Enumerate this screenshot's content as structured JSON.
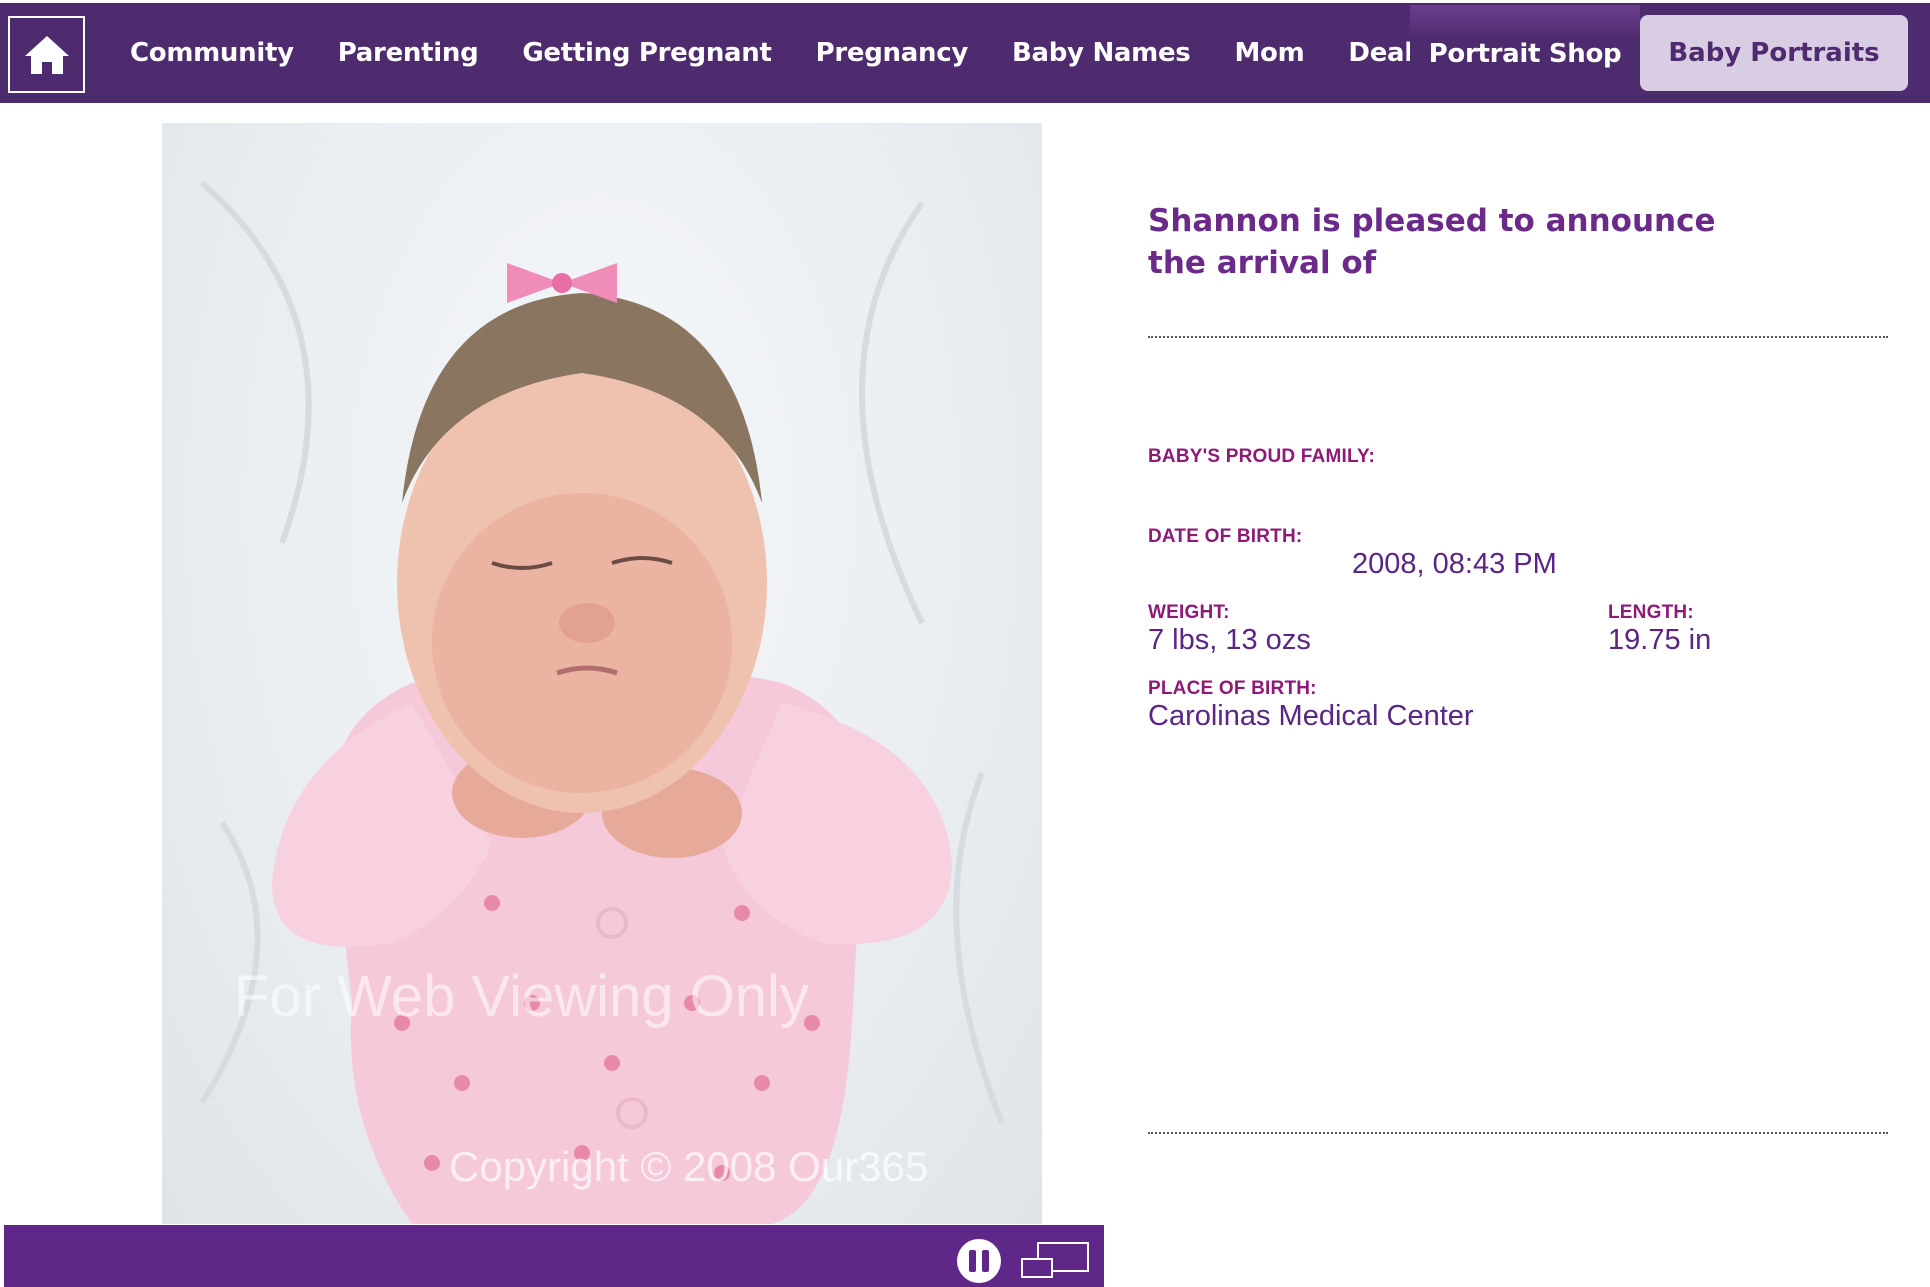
{
  "nav": {
    "home_icon": "home-icon",
    "items": [
      "Community",
      "Parenting",
      "Getting Pregnant",
      "Pregnancy",
      "Baby Names",
      "Mom",
      "Deals"
    ],
    "portrait_shop": "Portrait Shop",
    "baby_portraits": "Baby Portraits"
  },
  "photo": {
    "watermark_line1": "For Web Viewing Only",
    "watermark_line2": "Copyright © 2008 Our365"
  },
  "announcement": {
    "line1": "Shannon is pleased to announce",
    "line2": "the arrival of"
  },
  "details": {
    "family_label": "BABY'S PROUD FAMILY:",
    "dob_label": "DATE OF BIRTH:",
    "dob_value": "2008, 08:43 PM",
    "weight_label": "WEIGHT:",
    "weight_value": "7 lbs, 13 ozs",
    "length_label": "LENGTH:",
    "length_value": "19.75 in",
    "place_label": "PLACE OF BIRTH:",
    "place_value": "Carolinas Medical Center"
  },
  "slideshow": {
    "pause_icon": "pause-icon",
    "fullscreen_icon": "fullscreen-icon"
  },
  "colors": {
    "nav_bg": "#4e2a6e",
    "heading": "#6b2a8a",
    "label": "#8e1a78",
    "value": "#5a2585",
    "slide_bar": "#5f2888"
  }
}
